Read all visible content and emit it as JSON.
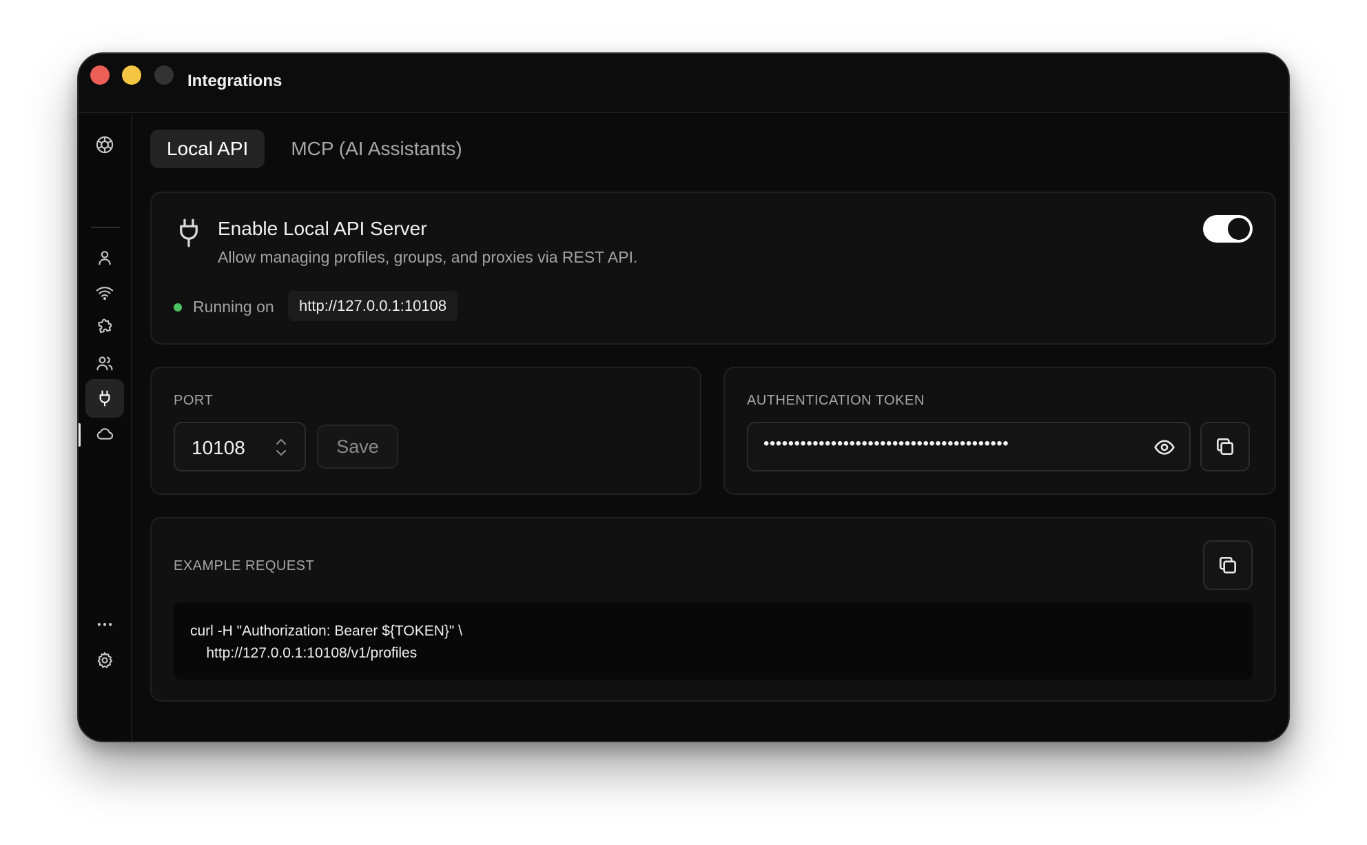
{
  "window": {
    "title": "Integrations"
  },
  "sidebar": {
    "items": [
      {
        "icon": "app-logo-icon"
      },
      {
        "icon": "user-icon"
      },
      {
        "icon": "wifi-icon"
      },
      {
        "icon": "puzzle-icon"
      },
      {
        "icon": "users-icon"
      },
      {
        "icon": "plug-icon",
        "active": true
      },
      {
        "icon": "cloud-icon"
      },
      {
        "icon": "more-icon"
      },
      {
        "icon": "gear-icon"
      }
    ]
  },
  "tabs": [
    {
      "label": "Local API",
      "active": true
    },
    {
      "label": "MCP (AI Assistants)",
      "active": false
    }
  ],
  "enable_card": {
    "title": "Enable Local API Server",
    "description": "Allow managing profiles, groups, and proxies via REST API.",
    "enabled": true,
    "status_label": "Running on",
    "url": "http://127.0.0.1:10108",
    "status_color": "#4cc461"
  },
  "port_card": {
    "label": "PORT",
    "value": "10108",
    "save_label": "Save"
  },
  "token_card": {
    "label": "AUTHENTICATION TOKEN",
    "masked_value": "••••••••••••••••••••••••••••••••••••••••"
  },
  "example_card": {
    "label": "EXAMPLE REQUEST",
    "code_lines": [
      "curl -H \"Authorization: Bearer ${TOKEN}\" \\",
      "    http://127.0.0.1:10108/v1/profiles"
    ]
  }
}
